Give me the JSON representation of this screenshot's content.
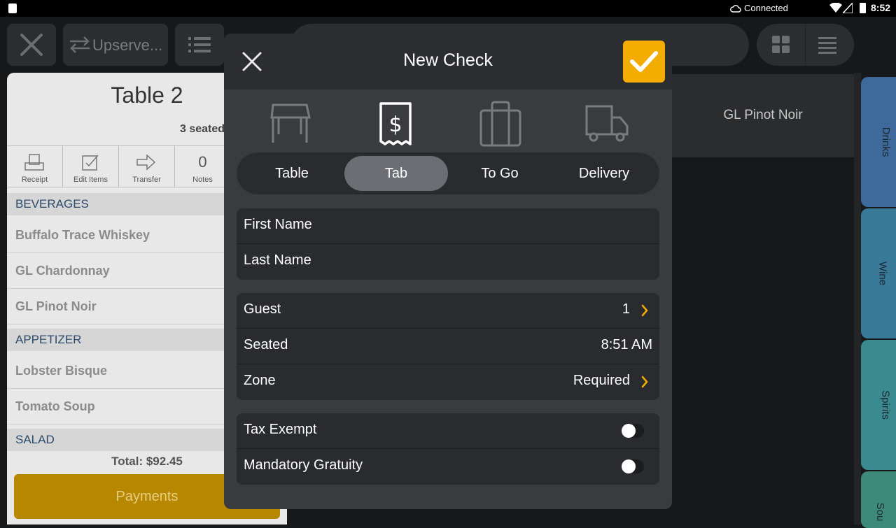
{
  "status_bar": {
    "connection": "Connected",
    "time": "8:52"
  },
  "toolbar": {
    "account_label": "Upserve..."
  },
  "check": {
    "title": "Table 2",
    "seated_info": "3 seated",
    "actions": [
      {
        "label": "Receipt"
      },
      {
        "label": "Edit Items"
      },
      {
        "label": "Transfer"
      },
      {
        "label": "Notes",
        "count": "0"
      }
    ],
    "sections": [
      {
        "name": "BEVERAGES",
        "items": [
          "Buffalo Trace Whiskey",
          "GL Chardonnay",
          "GL Pinot Noir"
        ]
      },
      {
        "name": "APPETIZER",
        "items": [
          "Lobster Bisque",
          "Tomato Soup"
        ]
      },
      {
        "name": "SALAD",
        "items": []
      }
    ],
    "total": "Total: $92.45",
    "payments_label": "Payments"
  },
  "menu": {
    "tile_label": "GL Pinot Noir",
    "categories": [
      {
        "label": "Drinks",
        "color": "#3d6a9a"
      },
      {
        "label": "Wine",
        "color": "#3a7a99"
      },
      {
        "label": "Spirits",
        "color": "#3a8a8f"
      },
      {
        "label": "Sou",
        "color": "#3e8a7a"
      }
    ]
  },
  "modal": {
    "title": "New Check",
    "check_types": [
      {
        "label": "Table",
        "icon": "table-icon",
        "active": false
      },
      {
        "label": "Tab",
        "icon": "receipt-dollar-icon",
        "active": true
      },
      {
        "label": "To Go",
        "icon": "shopping-bag-icon",
        "active": false
      },
      {
        "label": "Delivery",
        "icon": "truck-icon",
        "active": false
      }
    ],
    "name_fields": {
      "first_name": "First Name",
      "last_name": "Last Name"
    },
    "details": {
      "guest_label": "Guest",
      "guest_value": "1",
      "seated_label": "Seated",
      "seated_value": "8:51 AM",
      "zone_label": "Zone",
      "zone_value": "Required"
    },
    "options": {
      "tax_exempt_label": "Tax Exempt",
      "tax_exempt_on": false,
      "gratuity_label": "Mandatory Gratuity",
      "gratuity_on": false
    },
    "accent_color": "#f2ac02"
  }
}
